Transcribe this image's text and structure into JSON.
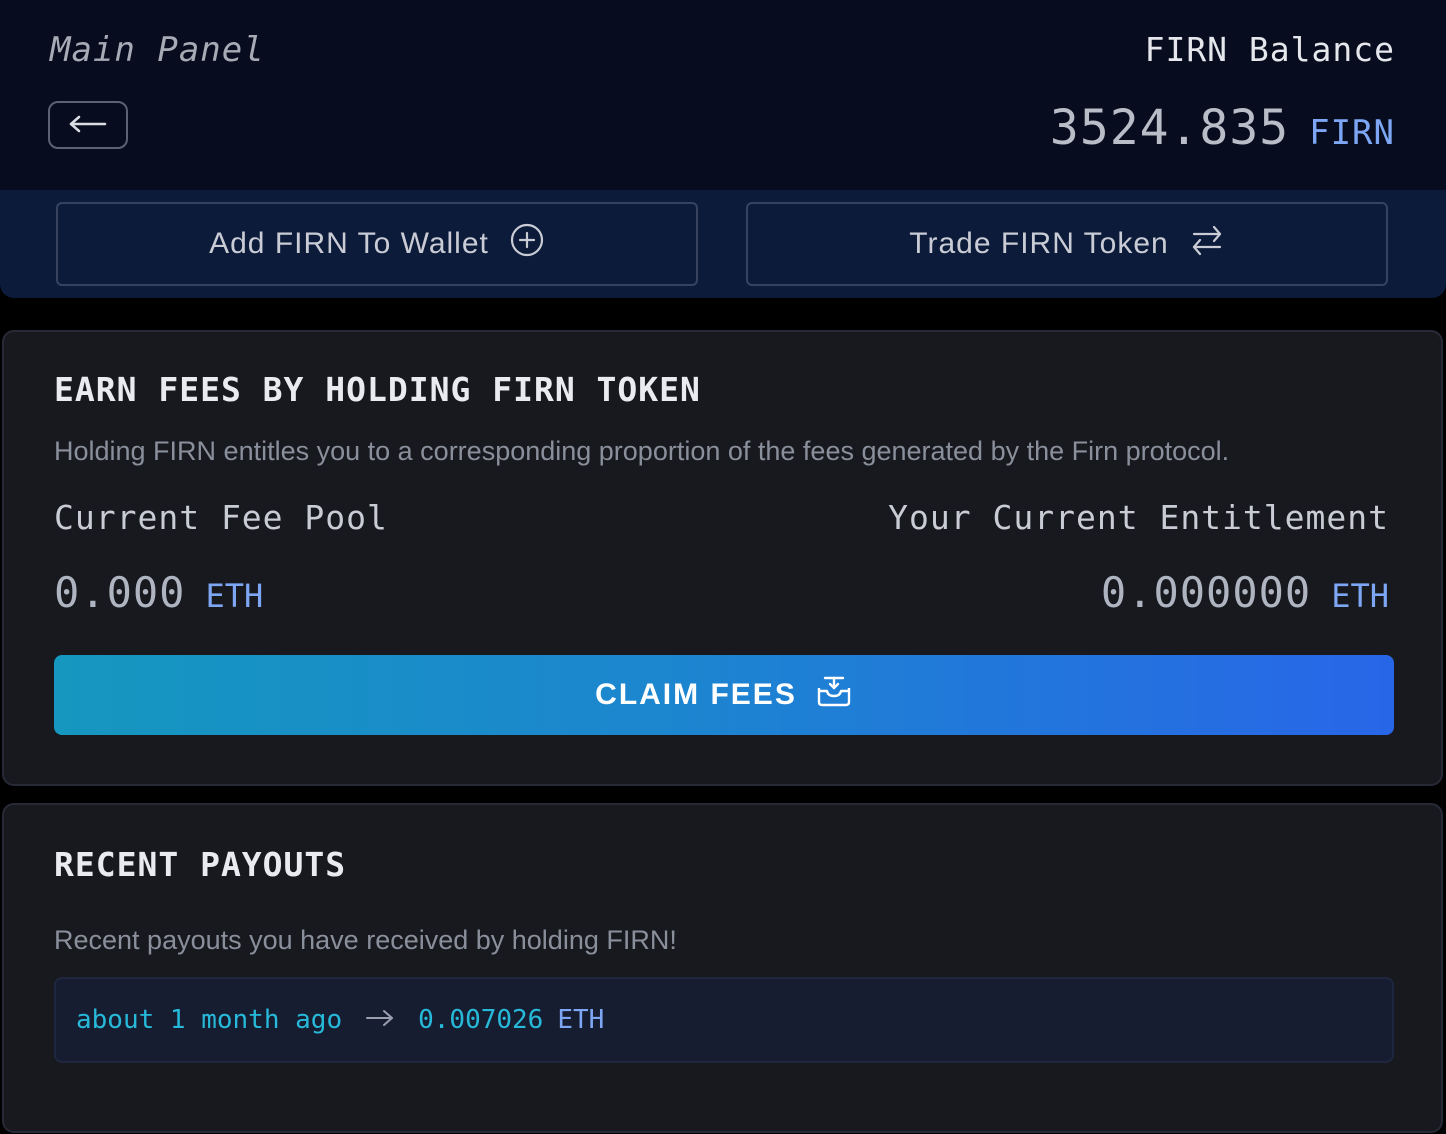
{
  "header": {
    "title": "Main Panel",
    "back_icon": "arrow-left-icon",
    "balance_label": "FIRN Balance",
    "balance_amount": "3524.835",
    "balance_unit": "FIRN"
  },
  "actions": {
    "add_label": "Add FIRN To Wallet",
    "add_icon": "plus-circle-icon",
    "trade_label": "Trade FIRN Token",
    "trade_icon": "swap-arrows-icon"
  },
  "earn": {
    "title": "EARN FEES BY HOLDING FIRN TOKEN",
    "description": "Holding FIRN entitles you to a corresponding proportion of the fees generated by the Firn protocol.",
    "fee_pool_label": "Current Fee Pool",
    "fee_pool_amount": "0.000",
    "fee_pool_unit": "ETH",
    "entitlement_label": "Your Current Entitlement",
    "entitlement_amount": "0.000000",
    "entitlement_unit": "ETH",
    "claim_label": "CLAIM FEES",
    "claim_icon": "inbox-download-icon"
  },
  "payouts": {
    "title": "RECENT PAYOUTS",
    "description": "Recent payouts you have received by holding FIRN!",
    "items": [
      {
        "time": "about 1 month ago",
        "amount": "0.007026",
        "unit": "ETH"
      }
    ]
  },
  "colors": {
    "accent_blue": "#7da7f5",
    "accent_cyan": "#27b9d9",
    "gradient_start": "#1597bf",
    "gradient_end": "#2866e8"
  }
}
